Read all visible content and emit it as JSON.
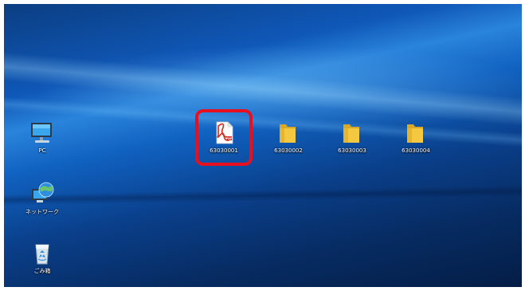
{
  "desktop": {
    "icons": [
      {
        "label": "PC",
        "icon": "computer-icon"
      },
      {
        "label": "ネットワーク",
        "icon": "network-icon"
      },
      {
        "label": "ごみ箱",
        "icon": "recycle-bin-icon"
      },
      {
        "label": "63030001",
        "icon": "pdf-file-icon"
      },
      {
        "label": "63030002",
        "icon": "folder-icon"
      },
      {
        "label": "63030003",
        "icon": "folder-icon"
      },
      {
        "label": "63030004",
        "icon": "folder-icon"
      }
    ],
    "highlight_color": "#e8101e",
    "wallpaper_color": "#0f58b8"
  }
}
